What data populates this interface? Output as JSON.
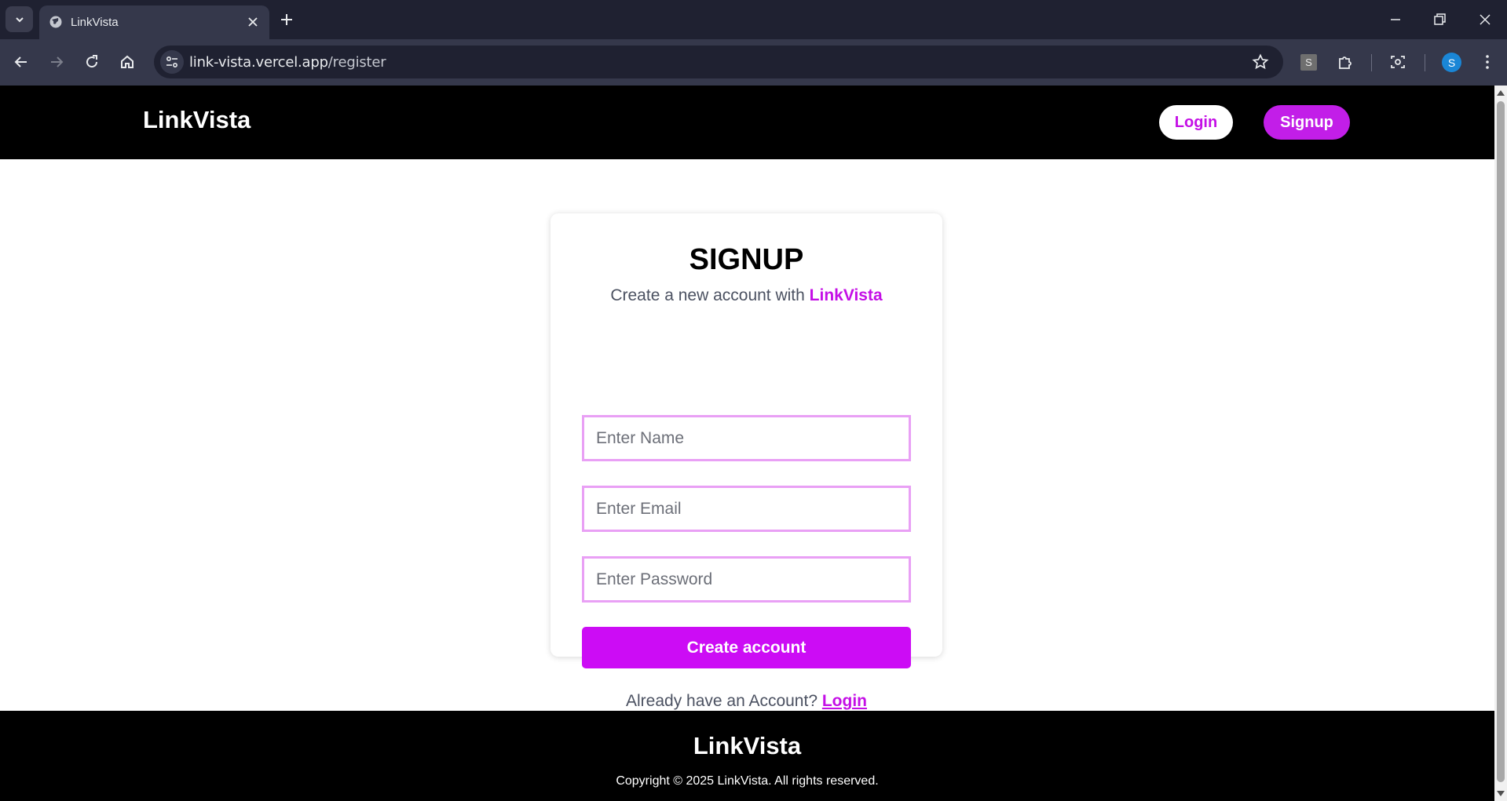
{
  "browser": {
    "tab_title": "LinkVista",
    "url_host": "link-vista.vercel.app",
    "url_path": "/register",
    "profile_initial": "S",
    "extension_label": "S"
  },
  "header": {
    "brand": "LinkVista",
    "login_label": "Login",
    "signup_label": "Signup"
  },
  "signup": {
    "title": "SIGNUP",
    "subtitle_prefix": "Create a new account with ",
    "subtitle_brand": "LinkVista",
    "name_placeholder": "Enter Name",
    "email_placeholder": "Enter Email",
    "password_placeholder": "Enter Password",
    "create_button": "Create account",
    "login_prompt": "Already have an Account? ",
    "login_link": "Login"
  },
  "footer": {
    "brand": "LinkVista",
    "copyright": "Copyright © 2025 LinkVista. All rights reserved."
  },
  "colors": {
    "accent": "#c40fe6",
    "button_primary": "#cc0cf5",
    "input_border": "#e9a0f5",
    "header_bg": "#000000"
  }
}
